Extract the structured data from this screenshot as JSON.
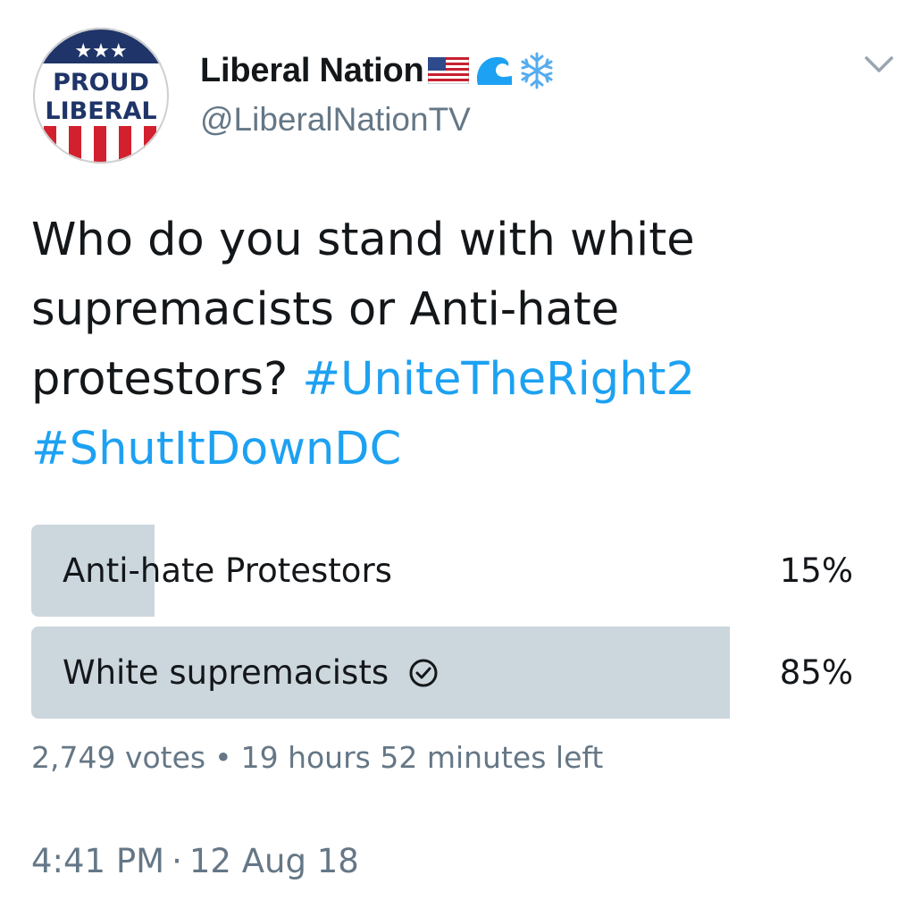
{
  "user": {
    "avatar": {
      "icon": "proud-liberal-badge",
      "line1": "PROUD",
      "line2": "LIBERAL",
      "stars": "★★★"
    },
    "display_name": "Liberal Nation",
    "name_emojis": [
      "us-flag-emoji",
      "wave-emoji",
      "snowflake-emoji"
    ],
    "handle": "@LiberalNationTV"
  },
  "tweet": {
    "text": "Who do you stand with white supremacists or Anti-hate protestors?",
    "hashtags": [
      "#UniteTheRight2",
      "#ShutItDownDC"
    ]
  },
  "poll": {
    "options": [
      {
        "label": "Anti-hate Protestors",
        "percent_text": "15%",
        "percent": 15,
        "selected": false
      },
      {
        "label": "White supremacists",
        "percent_text": "85%",
        "percent": 85,
        "selected": true
      }
    ],
    "votes": "2,749 votes",
    "separator": "•",
    "time_left": "19 hours 52 minutes left"
  },
  "meta": {
    "time": "4:41 PM",
    "separator": "·",
    "date": "12 Aug 18"
  },
  "colors": {
    "text": "#14171a",
    "muted": "#657786",
    "link": "#1da1f2",
    "poll_fill": "#ccd6dd",
    "avatar_navy": "#1f3468",
    "avatar_red": "#d3202f"
  }
}
